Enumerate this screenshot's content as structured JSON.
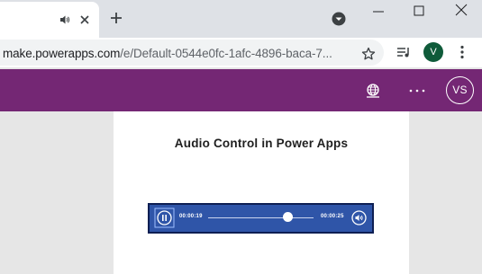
{
  "browser": {
    "url_host": "make.powerapps.com",
    "url_path": "/e/Default-0544e0fc-1afc-4896-baca-7...",
    "profile_initial": "V",
    "icons": {
      "tab_audio": "speaker-icon",
      "tab_close": "close-icon",
      "new_tab": "plus-icon",
      "tab_search": "chevron-down-circle-icon",
      "minimize": "minimize-icon",
      "maximize": "maximize-icon",
      "close": "close-icon",
      "bookmark": "star-icon",
      "reading_list": "reading-list-icon",
      "menu": "kebab-menu-icon"
    }
  },
  "header": {
    "avatar_initials": "VS",
    "icons": {
      "environment": "globe-icon",
      "more": "more-horizontal-icon"
    },
    "color": "#742774"
  },
  "screen": {
    "title": "Audio Control in Power Apps"
  },
  "audio": {
    "current_time": "00:00:19",
    "duration": "00:00:25",
    "progress": 0.76,
    "state": "playing",
    "icons": {
      "play_pause": "pause-icon",
      "volume": "volume-icon"
    },
    "background_color": "#2f55a8"
  }
}
